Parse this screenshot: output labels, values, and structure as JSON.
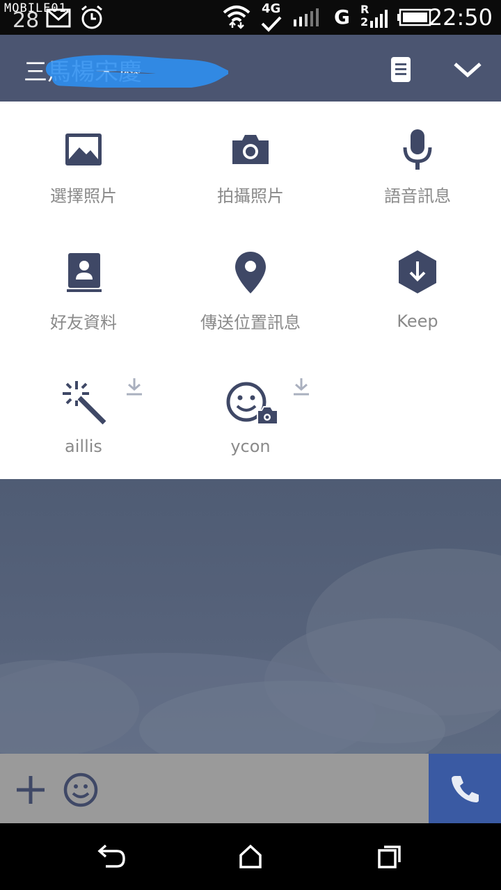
{
  "status_bar": {
    "watermark": "MOBILE01",
    "notification_count": "28",
    "network": "4G",
    "carrier_letter": "G",
    "roaming": "R",
    "sim_index": "2",
    "time": "22:50"
  },
  "header": {
    "title": "三馬楊宋慶"
  },
  "menu": {
    "row1": [
      {
        "label": "選擇照片",
        "icon": "photo-gallery-icon"
      },
      {
        "label": "拍攝照片",
        "icon": "camera-icon"
      },
      {
        "label": "語音訊息",
        "icon": "microphone-icon"
      }
    ],
    "row2": [
      {
        "label": "好友資料",
        "icon": "contact-card-icon"
      },
      {
        "label": "傳送位置訊息",
        "icon": "location-pin-icon"
      },
      {
        "label": "Keep",
        "icon": "keep-download-icon"
      }
    ],
    "row3": [
      {
        "label": "aillis",
        "icon": "magic-wand-icon",
        "downloadable": true
      },
      {
        "label": "ycon",
        "icon": "smiley-camera-icon",
        "downloadable": true
      }
    ]
  },
  "colors": {
    "header": "#4b5571",
    "icon": "#3f4866",
    "label": "#8a8a8a",
    "call_button": "#3a5aa3",
    "input_bar": "#9a9a9a"
  }
}
